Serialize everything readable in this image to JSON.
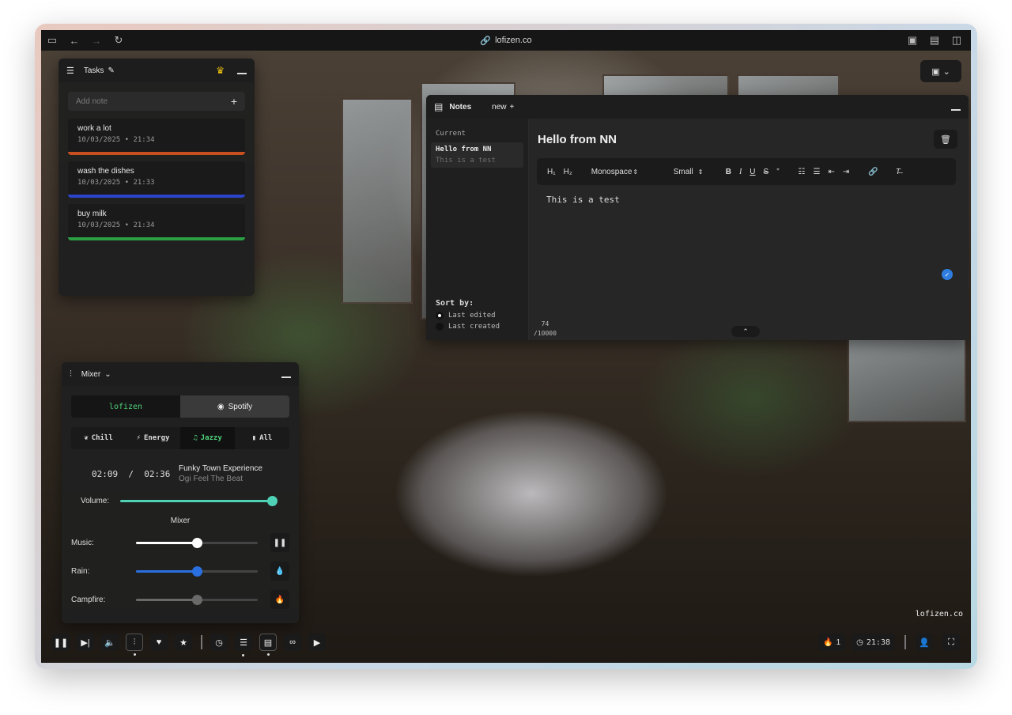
{
  "browser": {
    "url": "lofizen.co"
  },
  "tasks": {
    "title": "Tasks",
    "add_placeholder": "Add note",
    "items": [
      {
        "title": "work a lot",
        "date": "10/03/2025 • 21:34",
        "color": "#c8501e"
      },
      {
        "title": "wash the dishes",
        "date": "10/03/2025 • 21:33",
        "color": "#2b44c9"
      },
      {
        "title": "buy milk",
        "date": "10/03/2025 • 21:34",
        "color": "#2aa043"
      }
    ]
  },
  "notes": {
    "title": "Notes",
    "new_label": "new",
    "current_label": "Current",
    "current_note": {
      "title": "Hello from NN",
      "preview": "This is a test"
    },
    "note_title": "Hello from NN",
    "body": "This is a test",
    "sort_label": "Sort by:",
    "sort_options": [
      "Last edited",
      "Last created"
    ],
    "count": "74",
    "max": "/10000",
    "toolbar": {
      "h1": "H₁",
      "h2": "H₂",
      "font": "Monospace",
      "size": "Small",
      "bold": "B",
      "italic": "I",
      "underline": "U",
      "strike": "S",
      "quote": "”"
    }
  },
  "mixer": {
    "title": "Mixer",
    "sources": [
      "lofizen",
      "Spotify"
    ],
    "moods": [
      "Chill",
      "Energy",
      "Jazzy",
      "All"
    ],
    "active_mood": "Jazzy",
    "time": "02:09  /  02:36",
    "song": "Funky Town Experience",
    "artist": "Ogi Feel The Beat",
    "volume_label": "Volume:",
    "volume": 1.0,
    "mixer_label": "Mixer",
    "channels": [
      {
        "label": "Music:",
        "level": 0.5,
        "color": "#ffffff",
        "icon": "pause-icon"
      },
      {
        "label": "Rain:",
        "level": 0.5,
        "color": "#2a6fe0",
        "icon": "drop-icon"
      },
      {
        "label": "Campfire:",
        "level": 0.5,
        "color": "#6a6a6a",
        "icon": "flame-icon"
      }
    ],
    "accent": "#4fd1b5"
  },
  "dock": {
    "streak": "1",
    "clock": "21:38"
  },
  "scene": {
    "watermark": "lofizen.co"
  }
}
